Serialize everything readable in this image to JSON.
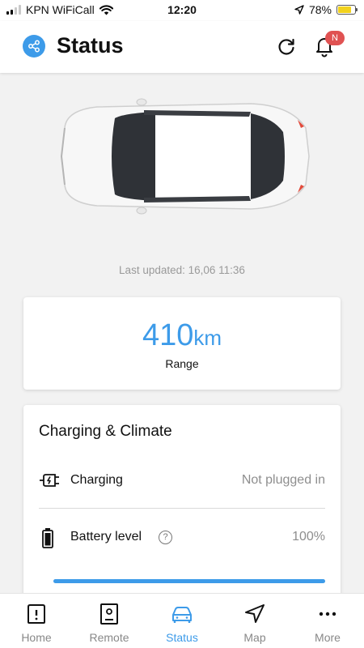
{
  "status_bar": {
    "carrier": "KPN WiFiCall",
    "time": "12:20",
    "battery_percent": "78%",
    "battery_level": 0.78
  },
  "header": {
    "title": "Status",
    "notification_badge": "N"
  },
  "vehicle": {
    "last_updated": "Last updated: 16,06 11:36"
  },
  "range": {
    "value": "410",
    "unit": "km",
    "label": "Range"
  },
  "charging_climate": {
    "title": "Charging & Climate",
    "charging_label": "Charging",
    "charging_value": "Not plugged in",
    "battery_label": "Battery level",
    "battery_value": "100%",
    "battery_level": 1.0
  },
  "bottom_nav": {
    "items": [
      {
        "label": "Home",
        "icon": "home-icon"
      },
      {
        "label": "Remote",
        "icon": "remote-icon"
      },
      {
        "label": "Status",
        "icon": "car-icon",
        "active": true
      },
      {
        "label": "Map",
        "icon": "navigation-arrow-icon"
      },
      {
        "label": "More",
        "icon": "more-dots-icon"
      }
    ]
  },
  "colors": {
    "accent": "#3d9be9",
    "badge": "#e05252",
    "background": "#f2f2f2"
  }
}
